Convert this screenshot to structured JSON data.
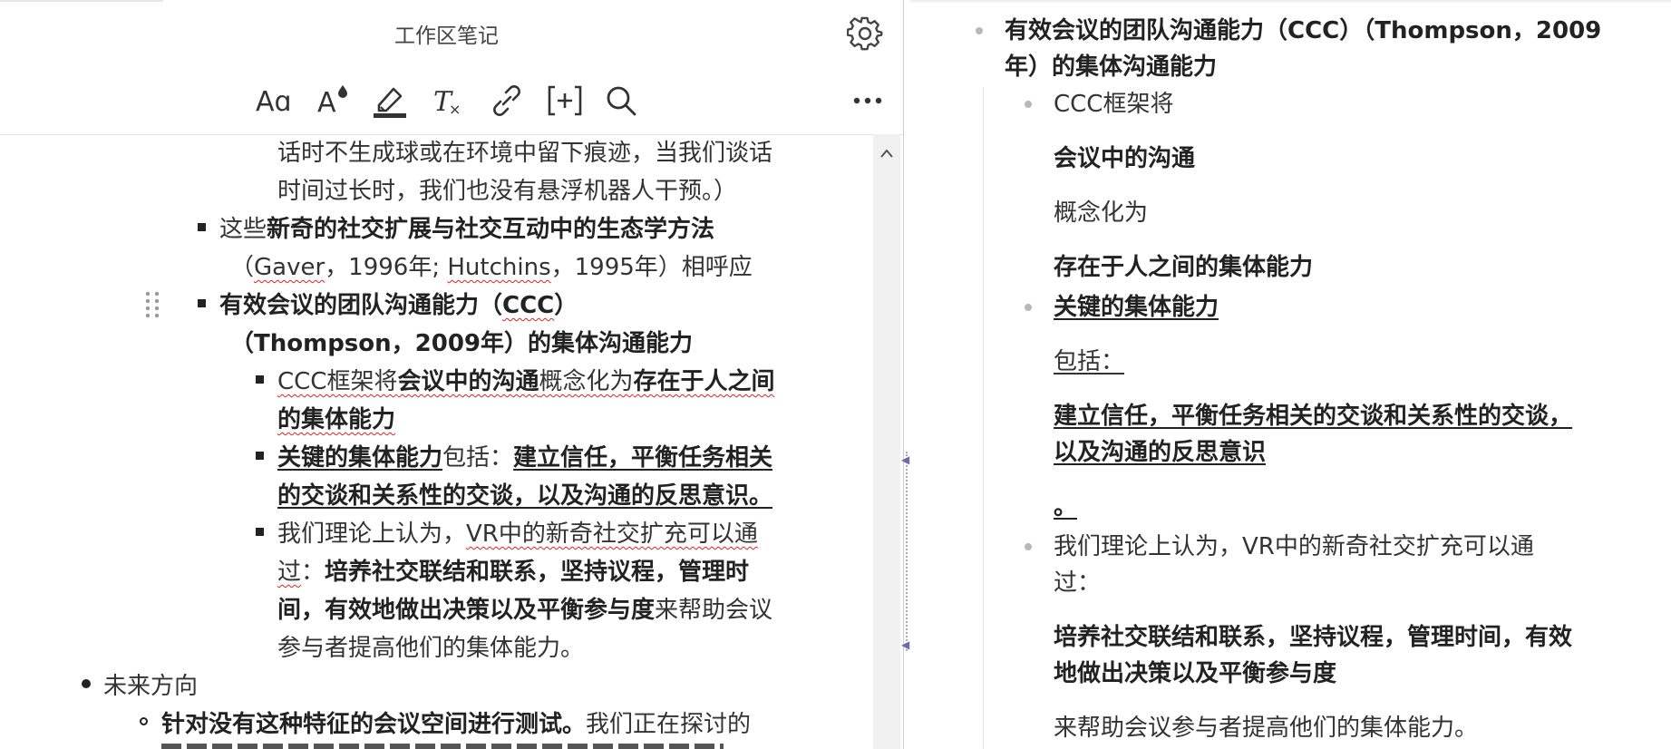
{
  "header": {
    "title": "工作区笔记"
  },
  "toolbar": {
    "font_icon_text": "Aa",
    "font_color_icon_text": "A"
  },
  "editor": {
    "continued": [
      "话时不生成球或在环境中留下痕迹，当我们谈话",
      "时间过长时，我们也没有悬浮机器人干预。）"
    ],
    "item_novel": {
      "prefix": "这些",
      "bold": "新奇的社交扩展与社交互动中的生态学方法",
      "cite_open": "（",
      "cite_a": "Gaver",
      "cite_b": "，1996年; ",
      "cite_c": "Hutchins",
      "cite_d": "，1995年）相呼应"
    },
    "item_ccc": {
      "line1_a": "有效会议的团队沟通能力（",
      "line1_b": "CCC",
      "line1_c": "）",
      "line2": "（Thompson，2009年）的集体沟通能力"
    },
    "sub1": {
      "a": "CCC框架将",
      "b": "会议中的沟通",
      "c": "概念化为",
      "d": "存在于人之间",
      "e": "的集体能力"
    },
    "sub2": {
      "a": "关键的集体能力",
      "b": "包括：",
      "c": "建立信任，平衡任务相关",
      "d": "的交谈和关系性的交谈，以及沟通的反思意识。"
    },
    "sub3": {
      "a": "我们理论上认为，",
      "b": "VR中的新奇社交扩充可以通",
      "c": "过",
      "d": "：",
      "e": "培养社交联结和联系，坚持议程，管理时",
      "f": "间，有效地做出决策以及平衡参与度",
      "g": "来帮助会议",
      "h": "参与者提高他们的集体能力。"
    },
    "future": {
      "label": "未来方向",
      "sub_bold": "针对没有这种特征的会议空间进行测试。",
      "sub_rest": "我们正在探讨的"
    }
  },
  "right": {
    "heading_line1": "有效会议的团队沟通能力（CCC）（Thompson，2009",
    "heading_line2": "年）的集体沟通能力",
    "b1": "CCC框架将",
    "b1_bold": "会议中的沟通",
    "b1_plain": "概念化为",
    "b1_bold2": "存在于人之间的集体能力",
    "b2": "关键的集体能力",
    "b2_plain": "包括：",
    "b2_bold_l1": "建立信任，平衡任务相关的交谈和关系性的交谈，",
    "b2_bold_l2": "以及沟通的反思意识",
    "b2_period": "。",
    "b3_l1": "我们理论上认为，VR中的新奇社交扩充可以通",
    "b3_l2": "过：",
    "b3_bold_l1": "培养社交联结和联系，坚持议程，管理时间，有效",
    "b3_bold_l2": "地做出决策以及平衡参与度",
    "b3_end": "来帮助会议参与者提高他们的集体能力。"
  },
  "colors": {
    "text": "#333333",
    "bold_text": "#222222",
    "spell_underline": "#e02020",
    "muted_bullet": "#b8b8b8"
  }
}
